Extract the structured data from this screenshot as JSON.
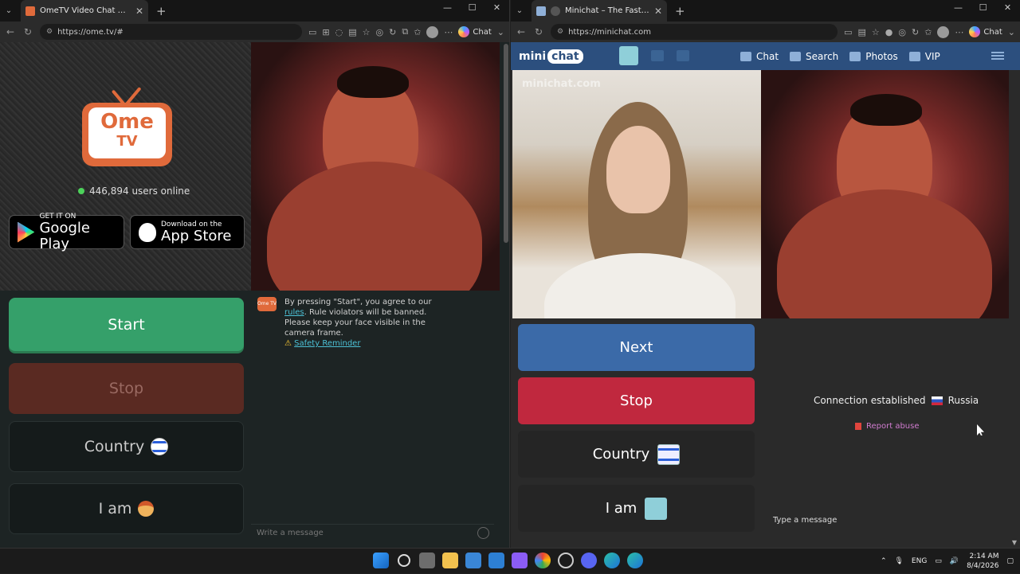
{
  "left_window": {
    "tab_title": "OmeTV Video Chat — Omegl",
    "url": "https://ome.tv/#",
    "copilot_label": "Chat",
    "page": {
      "logo_line1": "Ome",
      "logo_line2": "TV",
      "users_online": "446,894 users online",
      "google_play": {
        "small": "GET IT ON",
        "big": "Google Play"
      },
      "app_store": {
        "small": "Download on the",
        "big": "App Store"
      },
      "buttons": {
        "start": "Start",
        "stop": "Stop",
        "country": "Country",
        "iam": "I am"
      },
      "chat": {
        "notice_prefix": "By pressing \"Start\", you agree to our ",
        "notice_link": "rules",
        "notice_rest": ". Rule violators will be banned. Please keep your face visible in the camera frame.",
        "safety_link": "Safety Reminder",
        "input_placeholder": "Write a message"
      }
    }
  },
  "right_window": {
    "tab_title": "Minichat – The Fast Video Ch",
    "url": "https://minichat.com",
    "copilot_label": "Chat",
    "page": {
      "logo_a": "mini",
      "logo_b": "chat",
      "nav": {
        "chat": "Chat",
        "search": "Search",
        "photos": "Photos",
        "vip": "VIP"
      },
      "watermark": "minichat.com",
      "buttons": {
        "next": "Next",
        "stop": "Stop",
        "country": "Country",
        "iam": "I am"
      },
      "connection": "Connection established",
      "country_name": "Russia",
      "report": "Report abuse",
      "type_message": "Type a message"
    }
  },
  "taskbar": {
    "lang": "ENG",
    "time": "2:14 AM",
    "date": "8/4/2026"
  },
  "colors": {
    "ome_start": "#35a06a",
    "ome_accent": "#e06a3b",
    "mc_next": "#3b6aa8",
    "mc_stop": "#c0283e",
    "mc_header": "#2c4f7e"
  }
}
